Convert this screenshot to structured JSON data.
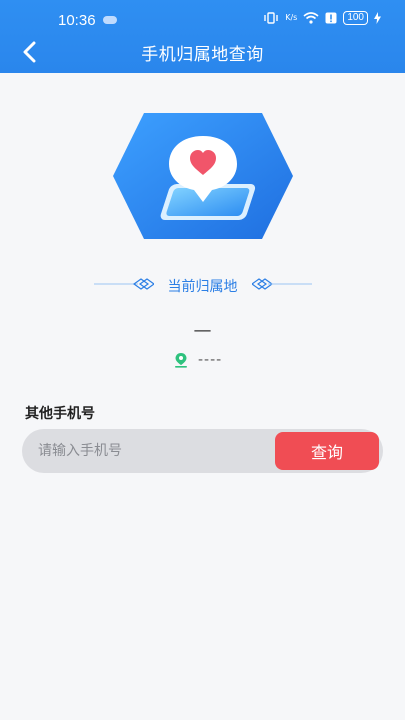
{
  "status_bar": {
    "time": "10:36",
    "net_speed_unit": "K/s",
    "battery": "100"
  },
  "header": {
    "title": "手机归属地查询"
  },
  "current": {
    "section_label": "当前归属地",
    "number_placeholder": "—",
    "location_placeholder": "----"
  },
  "other": {
    "label": "其他手机号",
    "input_placeholder": "请输入手机号",
    "input_value": "",
    "query_button": "查询"
  },
  "colors": {
    "header_blue": "#2f8ff2",
    "accent_blue": "#2c7fe5",
    "query_red": "#f04d54",
    "location_green": "#2ec27e"
  }
}
